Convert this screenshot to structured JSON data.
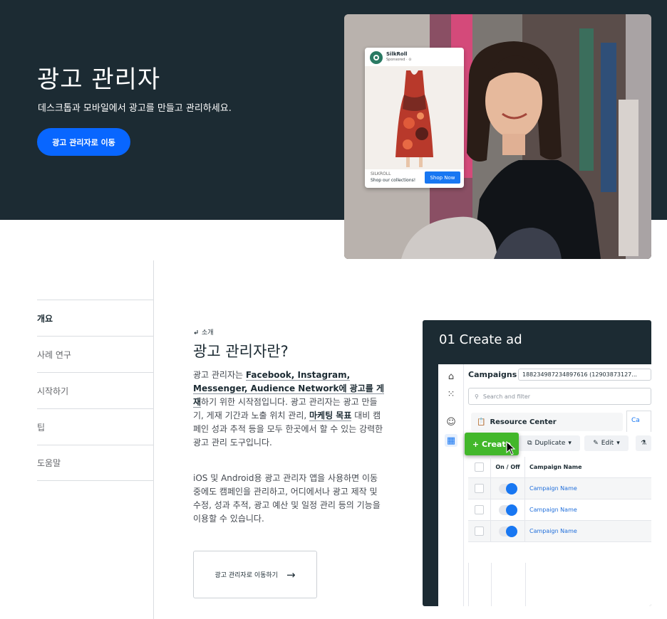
{
  "hero": {
    "title": "광고 관리자",
    "subtitle": "데스크톱과 모바일에서 광고를 만들고 관리하세요.",
    "cta_label": "광고 관리자로 이동"
  },
  "ad_preview": {
    "brand": "SilkRoll",
    "sponsored": "Sponsored · ⊙",
    "cta_brand": "SILKROLL",
    "cta_text": "Shop our collections!",
    "shop_label": "Shop Now"
  },
  "sidenav": {
    "items": [
      {
        "label": "개요",
        "active": true
      },
      {
        "label": "사례 연구"
      },
      {
        "label": "시작하기"
      },
      {
        "label": "팁"
      },
      {
        "label": "도움말"
      }
    ]
  },
  "article": {
    "eyebrow": "소개",
    "title": "광고 관리자란?",
    "p1": {
      "a": "광고 관리자는 ",
      "b": "Facebook, Instagram, Messenger, Audience Network에 광고를 게재",
      "c": "하기 위한 시작점입니다. 광고 관리자는 광고 만들기, 게재 기간과 노출 위치 관리, ",
      "d": "마케팅 목표",
      "e": " 대비 캠페인 성과 추적 등을 모두 한곳에서 할 수 있는 강력한 광고 관리 도구입니다."
    },
    "p2": "iOS 및 Android용 광고 관리자 앱을 사용하면 이동 중에도 캠페인을 관리하고, 어디에서나 광고 제작 및 수정, 성과 추적, 광고 예산 및 일정 관리 등의 기능을 이용할 수 있습니다.",
    "button_label": "광고 관리자로 이동하기"
  },
  "video": {
    "title": "01 Create ad",
    "campaigns_label": "Campaigns",
    "account_id": "188234987234897616 (12903873127...",
    "search_placeholder": "Search and filter",
    "resource_center": "Resource Center",
    "tab_partial": "Ca",
    "create_label": "+ Create",
    "duplicate_label": "Duplicate",
    "edit_label": "Edit",
    "table": {
      "headers": [
        "On / Off",
        "Campaign Name"
      ],
      "rows": [
        "Campaign Name",
        "Campaign Name",
        "Campaign Name"
      ]
    }
  }
}
